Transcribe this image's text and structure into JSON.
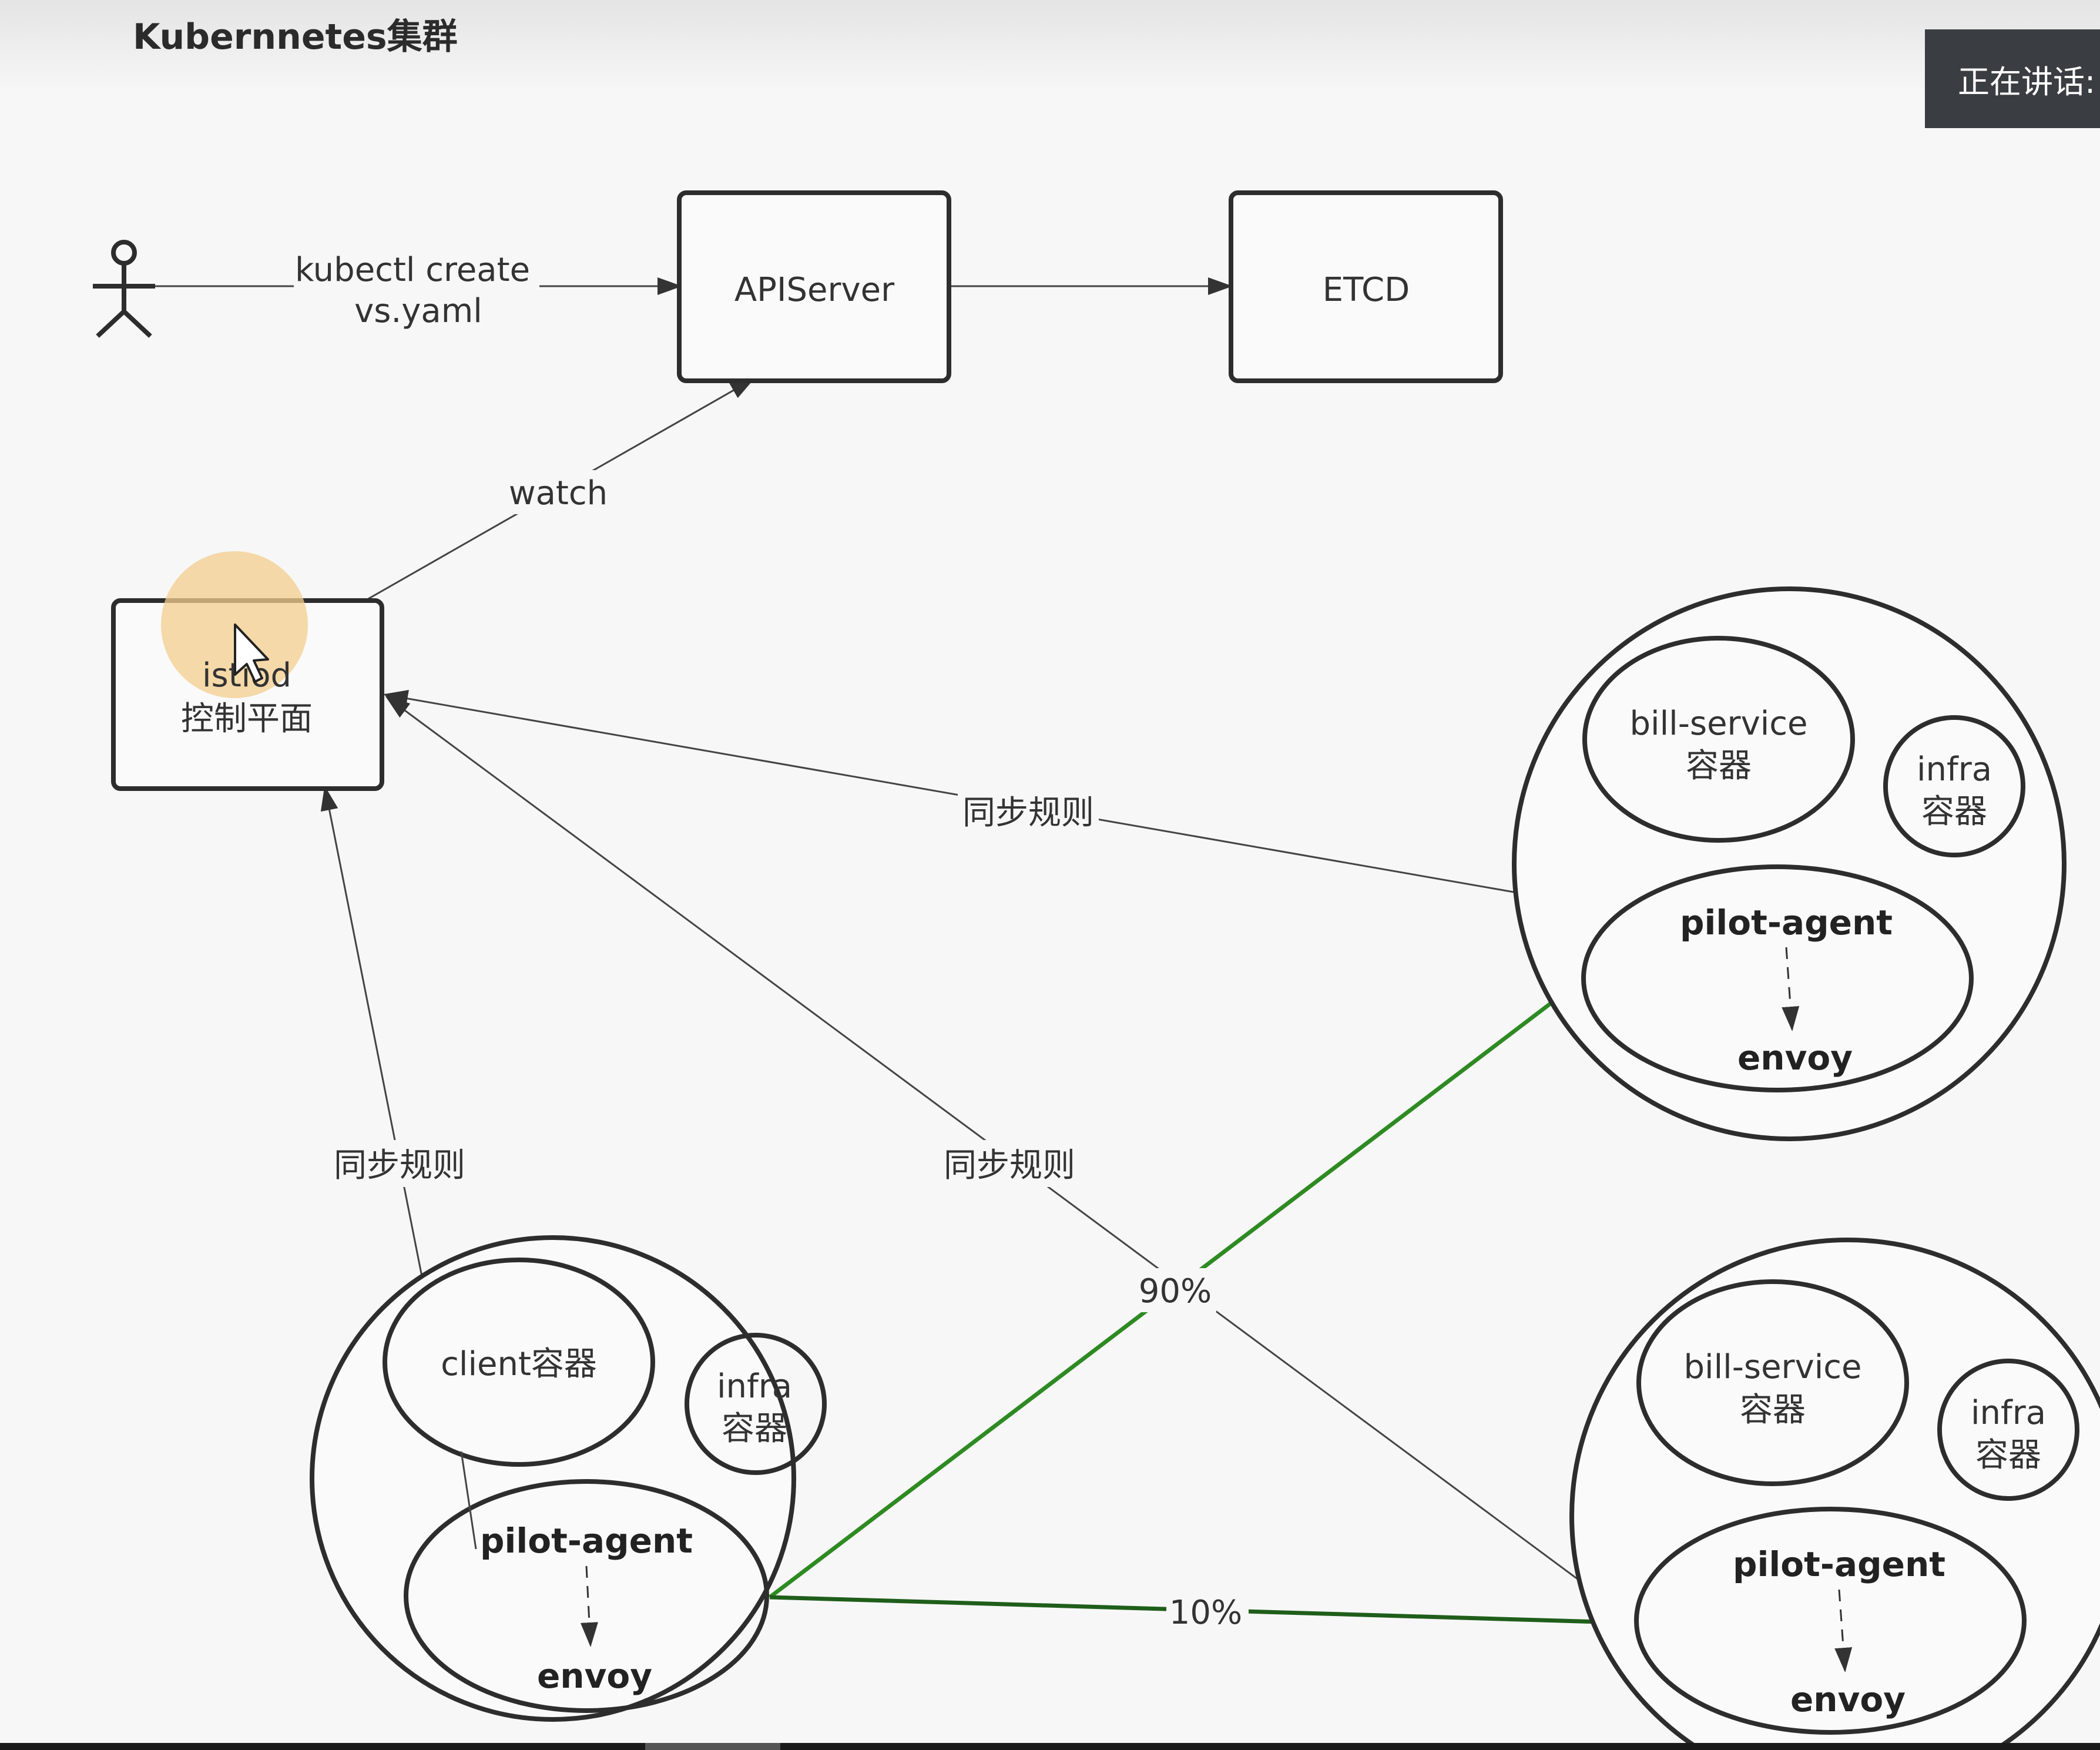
{
  "title": "Kubernnetes集群",
  "speaking_badge": "正在讲话:",
  "nodes": {
    "apiserver": "APIServer",
    "etcd": "ETCD",
    "istiod_line1": "istiod",
    "istiod_line2": "控制平面"
  },
  "edges": {
    "kubectl_line1": "kubectl create",
    "kubectl_line2": "vs.yaml",
    "watch": "watch",
    "sync_rule_top_right": "同步规则",
    "sync_rule_left": "同步规则",
    "sync_rule_middle": "同步规则",
    "traffic_90": "90%",
    "traffic_10": "10%"
  },
  "pods": {
    "client": {
      "main_container": "client容器",
      "infra_line1": "infra",
      "infra_line2": "容器",
      "pilot_agent": "pilot-agent",
      "envoy": "envoy"
    },
    "bill_service_1": {
      "main_line1": "bill-service",
      "main_line2": "容器",
      "infra_line1": "infra",
      "infra_line2": "容器",
      "pilot_agent": "pilot-agent",
      "envoy": "envoy"
    },
    "bill_service_2": {
      "main_line1": "bill-service",
      "main_line2": "容器",
      "infra_line1": "infra",
      "infra_line2": "容器",
      "pilot_agent": "pilot-agent",
      "envoy": "envoy"
    }
  },
  "colors": {
    "stroke": "#2d2d2d",
    "thin_line": "#444444",
    "traffic_green": "#2e8a22",
    "cursor_highlight": "#f3ce8c"
  }
}
